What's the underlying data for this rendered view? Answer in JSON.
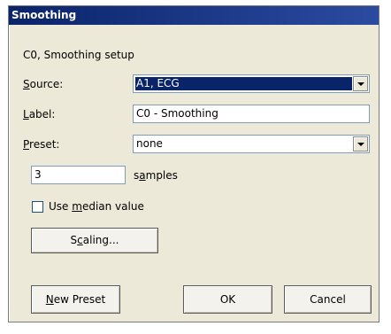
{
  "dialog": {
    "title": "Smoothing",
    "header_text": "C0, Smoothing setup"
  },
  "source": {
    "label_pre": "",
    "label_key": "S",
    "label_post": "ource:",
    "value": "A1, ECG"
  },
  "label_field": {
    "label_pre": "",
    "label_key": "L",
    "label_post": "abel:",
    "value": "C0 - Smoothing"
  },
  "preset": {
    "label_pre": "",
    "label_key": "P",
    "label_post": "reset:",
    "value": "none"
  },
  "samples": {
    "value": "3",
    "label_pre": "s",
    "label_key": "a",
    "label_post": "mples"
  },
  "median": {
    "label_pre": "Use ",
    "label_key": "m",
    "label_post": "edian value",
    "checked": false
  },
  "buttons": {
    "scaling_pre": "S",
    "scaling_key": "c",
    "scaling_post": "aling...",
    "new_preset_pre": "",
    "new_preset_key": "N",
    "new_preset_post": "ew Preset",
    "ok": "OK",
    "cancel": "Cancel"
  }
}
